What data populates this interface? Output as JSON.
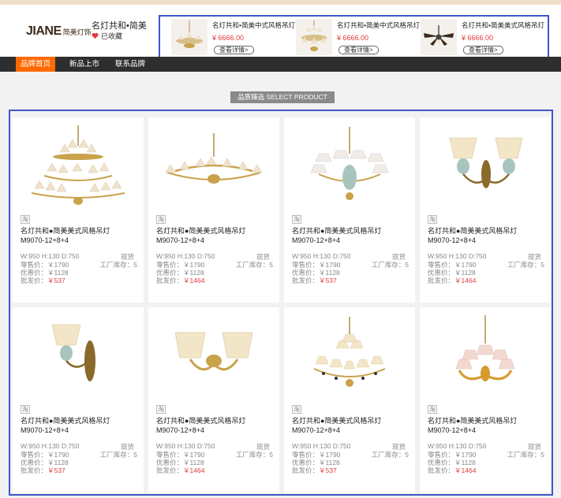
{
  "header": {
    "logo_mark": "JIANE",
    "logo_cn": "简美灯饰",
    "shop_name": "名灯共和•简美",
    "favorite_label": "已收藏"
  },
  "promos": [
    {
      "title": "名灯共和•简美中式风格吊灯",
      "price": "¥ 6666.00",
      "button": "查看详情>",
      "icon": "chandelier-image"
    },
    {
      "title": "名灯共和•简美中式风格吊灯",
      "price": "¥ 6666.00",
      "button": "查看详情>",
      "icon": "chandelier-image"
    },
    {
      "title": "名灯共和•简美美式风格吊灯",
      "price": "¥ 6666.00",
      "button": "查看详情>",
      "icon": "ceiling-fan-image"
    }
  ],
  "nav": {
    "items": [
      {
        "label": "品牌首页",
        "active": true
      },
      {
        "label": "新品上市",
        "active": false
      },
      {
        "label": "联系品牌",
        "active": false
      }
    ]
  },
  "section": {
    "title": "品质臻选 SELECT PRODUCT"
  },
  "products": [
    {
      "tag": "淘",
      "name": "名灯共和●简美美式风格吊灯",
      "model": "M9070-12+8+4",
      "spec": "W:950  H:130  D:750",
      "stock": "现货",
      "retail": "零售价：￥1790",
      "factory": "工厂库存：5",
      "promo": "优惠价：￥1128",
      "wholesale_label": "批发价：",
      "wholesale_value": "￥537",
      "image": "tiered-chandelier-image"
    },
    {
      "tag": "淘",
      "name": "名灯共和●简美美式风格吊灯",
      "model": "M9070-12+8+4",
      "spec": "W:950  H:130  D:750",
      "stock": "现货",
      "retail": "零售价：￥1790",
      "factory": "工厂库存：5",
      "promo": "优惠价：￥1128",
      "wholesale_label": "批发价：",
      "wholesale_value": "￥1464",
      "image": "flat-chandelier-image"
    },
    {
      "tag": "淘",
      "name": "名灯共和●简美美式风格吊灯",
      "model": "M9070-12+8+4",
      "spec": "W:950  H:130  D:750",
      "stock": "现货",
      "retail": "零售价：￥1790",
      "factory": "工厂库存：5",
      "promo": "优惠价：￥1128",
      "wholesale_label": "批发价：",
      "wholesale_value": "￥537",
      "image": "shade-chandelier-image"
    },
    {
      "tag": "淘",
      "name": "名灯共和●简美美式风格吊灯",
      "model": "M9070-12+8+4",
      "spec": "W:950  H:130  D:750",
      "stock": "现货",
      "retail": "零售价：￥1790",
      "factory": "工厂库存：5",
      "promo": "优惠价：￥1128",
      "wholesale_label": "批发价：",
      "wholesale_value": "￥1464",
      "image": "double-wall-lamp-image"
    },
    {
      "tag": "淘",
      "name": "名灯共和●简美美式风格吊灯",
      "model": "M9070-12+8+4",
      "spec": "W:950  H:130  D:750",
      "stock": "现货",
      "retail": "零售价：￥1790",
      "factory": "工厂库存：5",
      "promo": "优惠价：￥1128",
      "wholesale_label": "批发价：",
      "wholesale_value": "￥537",
      "image": "single-wall-lamp-image"
    },
    {
      "tag": "淘",
      "name": "名灯共和●简美美式风格吊灯",
      "model": "M9070-12+8+4",
      "spec": "W:950  H:130  D:750",
      "stock": "现货",
      "retail": "零售价：￥1790",
      "factory": "工厂库存：5",
      "promo": "优惠价：￥1128",
      "wholesale_label": "批发价：",
      "wholesale_value": "￥1464",
      "image": "double-wall-lamp-image"
    },
    {
      "tag": "淘",
      "name": "名灯共和●简美美式风格吊灯",
      "model": "M9070-12+8+4",
      "spec": "W:950  H:130  D:750",
      "stock": "现货",
      "retail": "零售价：￥1790",
      "factory": "工厂库存：5",
      "promo": "优惠价：￥1128",
      "wholesale_label": "批发价：",
      "wholesale_value": "￥537",
      "image": "crystal-chandelier-image"
    },
    {
      "tag": "淘",
      "name": "名灯共和●简美美式风格吊灯",
      "model": "M9070-12+8+4",
      "spec": "W:950  H:130  D:750",
      "stock": "现货",
      "retail": "零售价：￥1790",
      "factory": "工厂库存：5",
      "promo": "优惠价：￥1128",
      "wholesale_label": "批发价：",
      "wholesale_value": "￥1464",
      "image": "pink-shade-chandelier-image"
    }
  ],
  "colors": {
    "accent": "#ff6a00",
    "price_red": "#e4393c",
    "highlight_border": "#3d57c9",
    "gold": "#c9a24a"
  }
}
